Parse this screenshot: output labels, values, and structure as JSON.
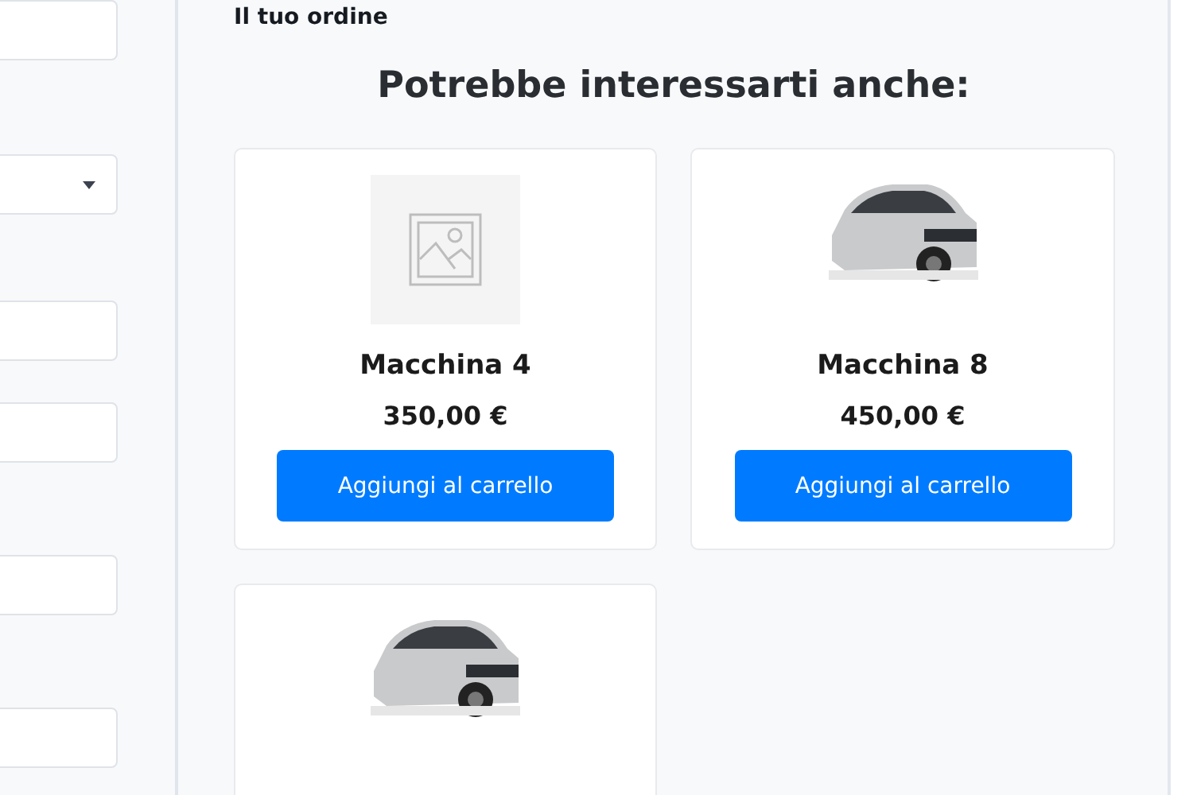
{
  "form_fields": [
    {
      "kind": "text"
    },
    {
      "kind": "select"
    },
    {
      "kind": "text"
    },
    {
      "kind": "text"
    },
    {
      "kind": "text"
    },
    {
      "kind": "text"
    }
  ],
  "order_title": "Il tuo ordine",
  "section_heading": "Potrebbe interessarti anche:",
  "products": [
    {
      "kind": "placeholder",
      "name": "Macchina 4",
      "price": "350,00 €",
      "button": "Aggiungi al carrello"
    },
    {
      "kind": "photo",
      "name": "Macchina 8",
      "price": "450,00 €",
      "button": "Aggiungi al carrello"
    },
    {
      "kind": "photo"
    }
  ]
}
